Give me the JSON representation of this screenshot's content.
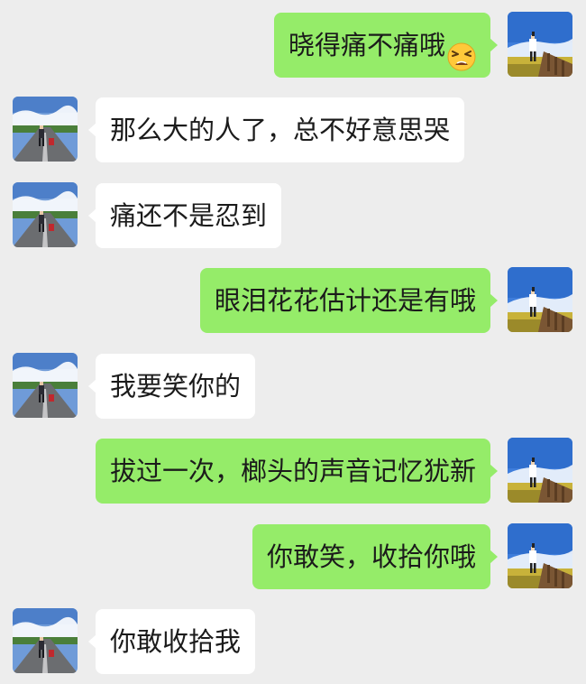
{
  "colors": {
    "background": "#ededed",
    "sent_bubble": "#95ec69",
    "received_bubble": "#ffffff",
    "text": "#1b1b1b"
  },
  "messages": [
    {
      "side": "right",
      "text": "晓得痛不痛哦",
      "emoji": "tired-face-emoji",
      "avatar": "user-photo-sky"
    },
    {
      "side": "left",
      "text": "那么大的人了，总不好意思哭",
      "avatar": "contact-photo-road"
    },
    {
      "side": "left",
      "text": "痛还不是忍到",
      "avatar": "contact-photo-road"
    },
    {
      "side": "right",
      "text": "眼泪花花估计还是有哦",
      "avatar": "user-photo-sky"
    },
    {
      "side": "left",
      "text": "我要笑你的",
      "avatar": "contact-photo-road"
    },
    {
      "side": "right",
      "text": "拔过一次，榔头的声音记忆犹新",
      "avatar": "user-photo-sky"
    },
    {
      "side": "right",
      "text": "你敢笑，收拾你哦",
      "avatar": "user-photo-sky"
    },
    {
      "side": "left",
      "text": "你敢收拾我",
      "avatar": "contact-photo-road"
    }
  ]
}
